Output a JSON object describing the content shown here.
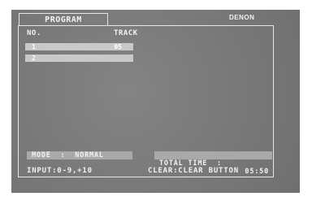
{
  "brand": "DENON",
  "tab": {
    "label": "PROGRAM"
  },
  "table": {
    "headers": {
      "no": "NO.",
      "track": "TRACK"
    },
    "rows": [
      {
        "no": "1",
        "track": "05"
      },
      {
        "no": "2",
        "track": ""
      }
    ]
  },
  "status": {
    "mode": "MODE  :  NORMAL",
    "total_time_label": "TOTAL TIME  :",
    "total_time_value": "05:50"
  },
  "footer": {
    "input_hint": "INPUT:0-9,+10",
    "clear_hint": "CLEAR:CLEAR BUTTON"
  }
}
